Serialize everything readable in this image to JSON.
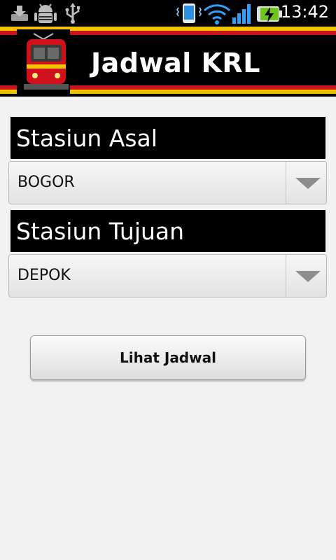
{
  "statusbar": {
    "time": "13:42",
    "icons": [
      "download-icon",
      "android-debug-icon",
      "usb-icon",
      "vibrate-icon",
      "wifi-icon",
      "signal-icon",
      "battery-charging-icon"
    ]
  },
  "banner": {
    "title": "Jadwal KRL",
    "logo": "train-icon"
  },
  "origin": {
    "label": "Stasiun Asal",
    "selected": "BOGOR"
  },
  "destination": {
    "label": "Stasiun Tujuan",
    "selected": "DEPOK"
  },
  "action": {
    "button_label": "Lihat Jadwal"
  },
  "colors": {
    "banner_yellow": "#f4c400",
    "banner_red": "#c8141c",
    "background": "#f2f2f2"
  }
}
